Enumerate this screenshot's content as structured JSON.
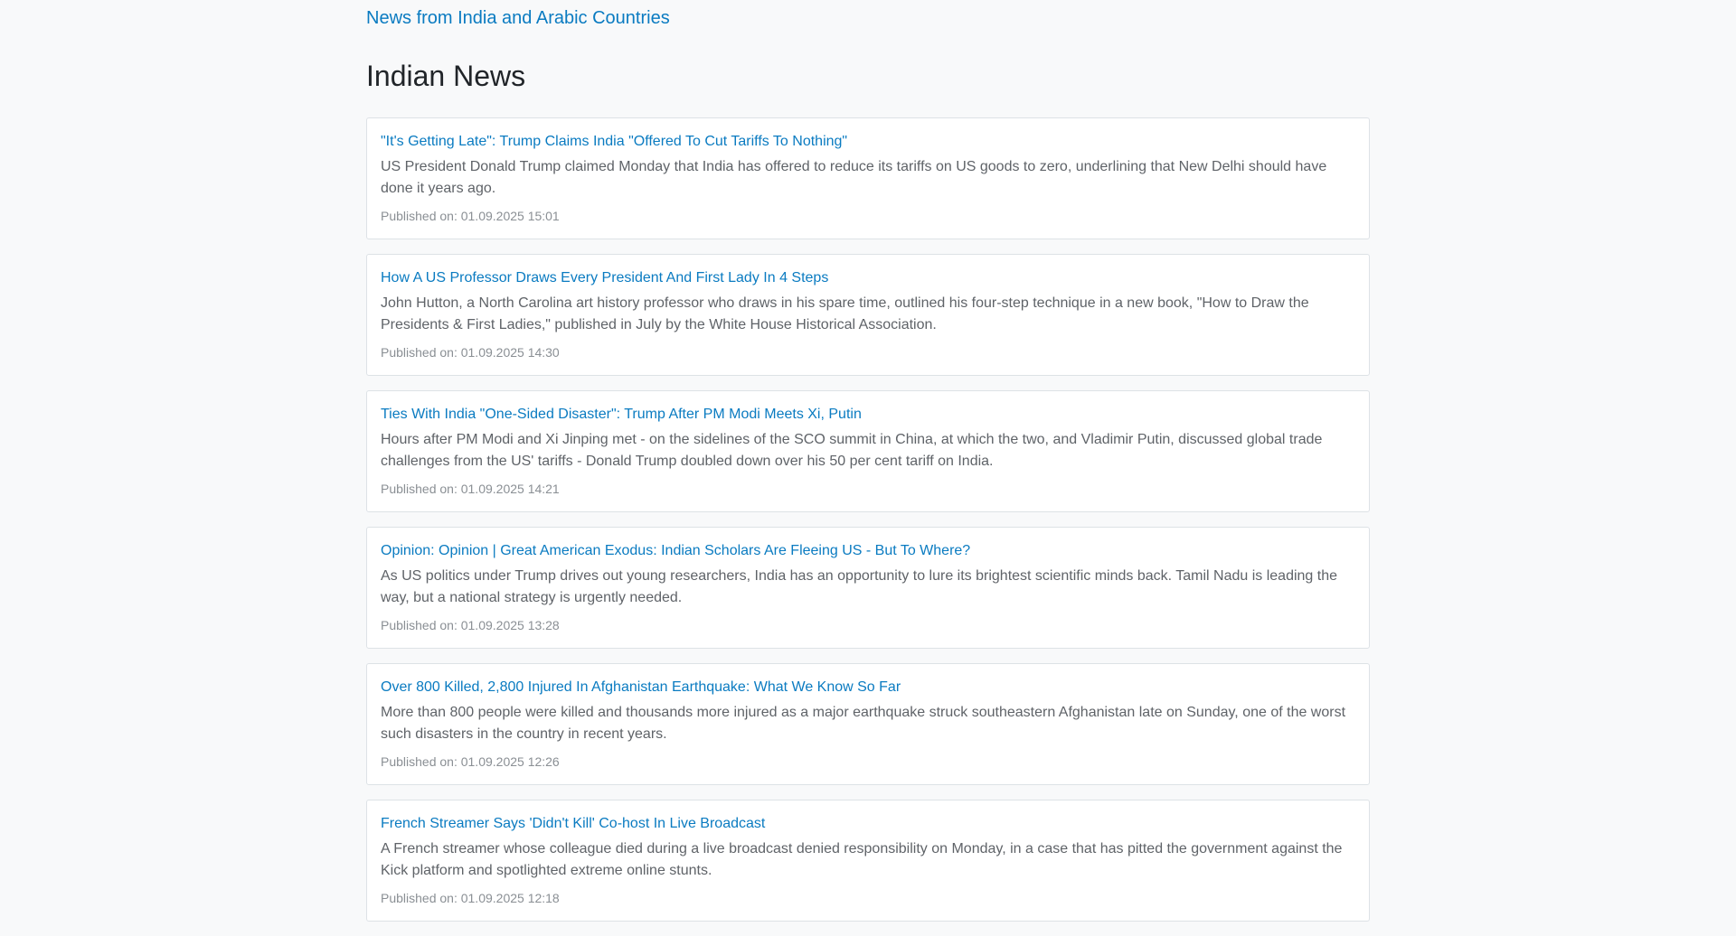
{
  "header": {
    "site_link": "News from India and Arabic Countries"
  },
  "section": {
    "title": "Indian News"
  },
  "articles": [
    {
      "title": "\"It's Getting Late\": Trump Claims India \"Offered To Cut Tariffs To Nothing\"",
      "description": "US President Donald Trump claimed Monday that India has offered to reduce its tariffs on US goods to zero, underlining that New Delhi should have done it years ago.",
      "published": "Published on: 01.09.2025 15:01"
    },
    {
      "title": "How A US Professor Draws Every President And First Lady In 4 Steps",
      "description": "John Hutton, a North Carolina art history professor who draws in his spare time, outlined his four-step technique in a new book, \"How to Draw the Presidents & First Ladies,\" published in July by the White House Historical Association.",
      "published": "Published on: 01.09.2025 14:30"
    },
    {
      "title": "Ties With India \"One-Sided Disaster\": Trump After PM Modi Meets Xi, Putin",
      "description": "Hours after PM Modi and Xi Jinping met - on the sidelines of the SCO summit in China, at which the two, and Vladimir Putin, discussed global trade challenges from the US' tariffs - Donald Trump doubled down over his 50 per cent tariff on India.",
      "published": "Published on: 01.09.2025 14:21"
    },
    {
      "title": "Opinion: Opinion | Great American Exodus: Indian Scholars Are Fleeing US - But To Where?",
      "description": "As US politics under Trump drives out young researchers, India has an opportunity to lure its brightest scientific minds back. Tamil Nadu is leading the way, but a national strategy is urgently needed.",
      "published": "Published on: 01.09.2025 13:28"
    },
    {
      "title": "Over 800 Killed, 2,800 Injured In Afghanistan Earthquake: What We Know So Far",
      "description": "More than 800 people were killed and thousands more injured as a major earthquake struck southeastern Afghanistan late on Sunday, one of the worst such disasters in the country in recent years.",
      "published": "Published on: 01.09.2025 12:26"
    },
    {
      "title": "French Streamer Says 'Didn't Kill' Co-host In Live Broadcast",
      "description": "A French streamer whose colleague died during a live broadcast denied responsibility on Monday, in a case that has pitted the government against the Kick platform and spotlighted extreme online stunts.",
      "published": "Published on: 01.09.2025 12:18"
    }
  ]
}
